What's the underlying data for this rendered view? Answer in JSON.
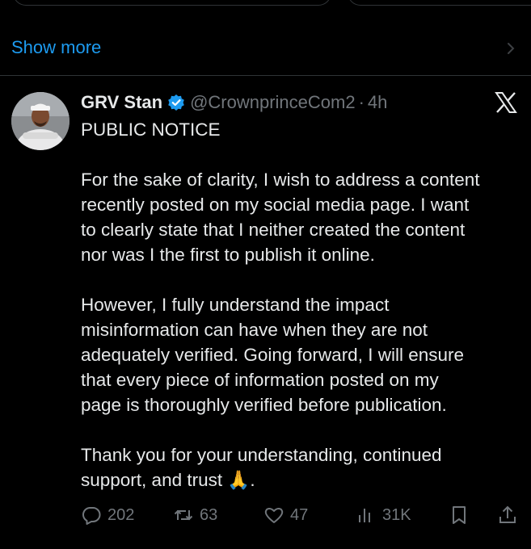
{
  "show_more": "Show more",
  "tweet": {
    "author": "GRV Stan",
    "handle": "@CrownprinceCom2",
    "separator": "·",
    "time": "4h",
    "lines": [
      "PUBLIC NOTICE",
      "",
      "For the sake of clarity, I wish to address a content",
      "recently posted on my social media page. I want",
      "to clearly state that I neither created the content",
      "nor was I the first to publish it online.",
      "",
      "However, I fully understand the impact",
      "misinformation can have when they are not",
      "adequately verified. Going forward, I will ensure",
      "that every piece of information posted on my",
      "page is thoroughly verified before publication.",
      "",
      "Thank you for your understanding, continued",
      "support, and trust 🙏."
    ]
  },
  "actions": {
    "replies": "202",
    "reposts": "63",
    "likes": "47",
    "views": "31K"
  },
  "icons": {
    "verified": "verified-badge-icon",
    "brand": "x-logo-icon",
    "reply": "reply-icon",
    "repost": "repost-icon",
    "like": "like-icon",
    "views": "views-icon",
    "bookmark": "bookmark-icon",
    "share": "share-icon"
  },
  "colors": {
    "background": "#000000",
    "text": "#e7e9ea",
    "muted": "#71767b",
    "link": "#1d9bf0",
    "verified": "#1d9bf0"
  }
}
